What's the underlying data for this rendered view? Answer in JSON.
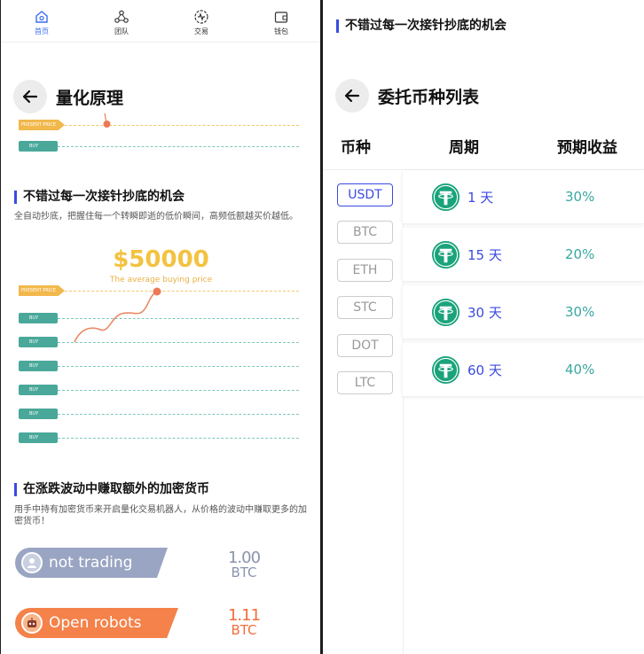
{
  "colors": {
    "accent": "#3b4be0",
    "tether": "#1aa37a",
    "present": "#f2b84b",
    "buy": "#4aa89a",
    "orange": "#f26d3d",
    "gray_btn": "#9aa5c3"
  },
  "left": {
    "tabs": [
      {
        "label": "首页",
        "icon": "home-icon",
        "active": true
      },
      {
        "label": "团队",
        "icon": "team-icon"
      },
      {
        "label": "交易",
        "icon": "trade-icon"
      },
      {
        "label": "钱包",
        "icon": "wallet-icon"
      }
    ],
    "page_title": "量化原理",
    "chart_small": {
      "present_label": "PRESENT PRICE",
      "buy_label": "BUY"
    },
    "section1": {
      "title": "不错过每一次接针抄底的机会",
      "desc": "全自动抄底，把握住每一个转瞬即逝的低价瞬间，高频低额越买价越低。"
    },
    "price": {
      "value": "$50000",
      "sub": "The average buying price"
    },
    "chart_main": {
      "present_label": "PRESENT PRICE",
      "buy_labels": [
        "BUY",
        "BUY",
        "BUY",
        "BUY",
        "BUY",
        "BUY"
      ]
    },
    "section2": {
      "title": "在涨跌波动中赚取额外的加密货币",
      "desc": "用手中持有加密货币来开启量化交易机器人，从价格的波动中赚取更多的加密货币！"
    },
    "robots": [
      {
        "label": "not trading",
        "amount": "1.00",
        "unit": "BTC"
      },
      {
        "label": "Open robots",
        "amount": "1.11",
        "unit": "BTC"
      }
    ]
  },
  "right": {
    "top_section_title": "不错过每一次接针抄底的机会",
    "page_title": "委托币种列表",
    "columns": [
      "币种",
      "周期",
      "预期收益"
    ],
    "coins": [
      "USDT",
      "BTC",
      "ETH",
      "STC",
      "DOT",
      "LTC"
    ],
    "selected_coin": "USDT",
    "periods": [
      {
        "days": "1 天",
        "yield": "30%"
      },
      {
        "days": "15 天",
        "yield": "20%"
      },
      {
        "days": "30 天",
        "yield": "30%"
      },
      {
        "days": "60 天",
        "yield": "40%"
      }
    ]
  }
}
